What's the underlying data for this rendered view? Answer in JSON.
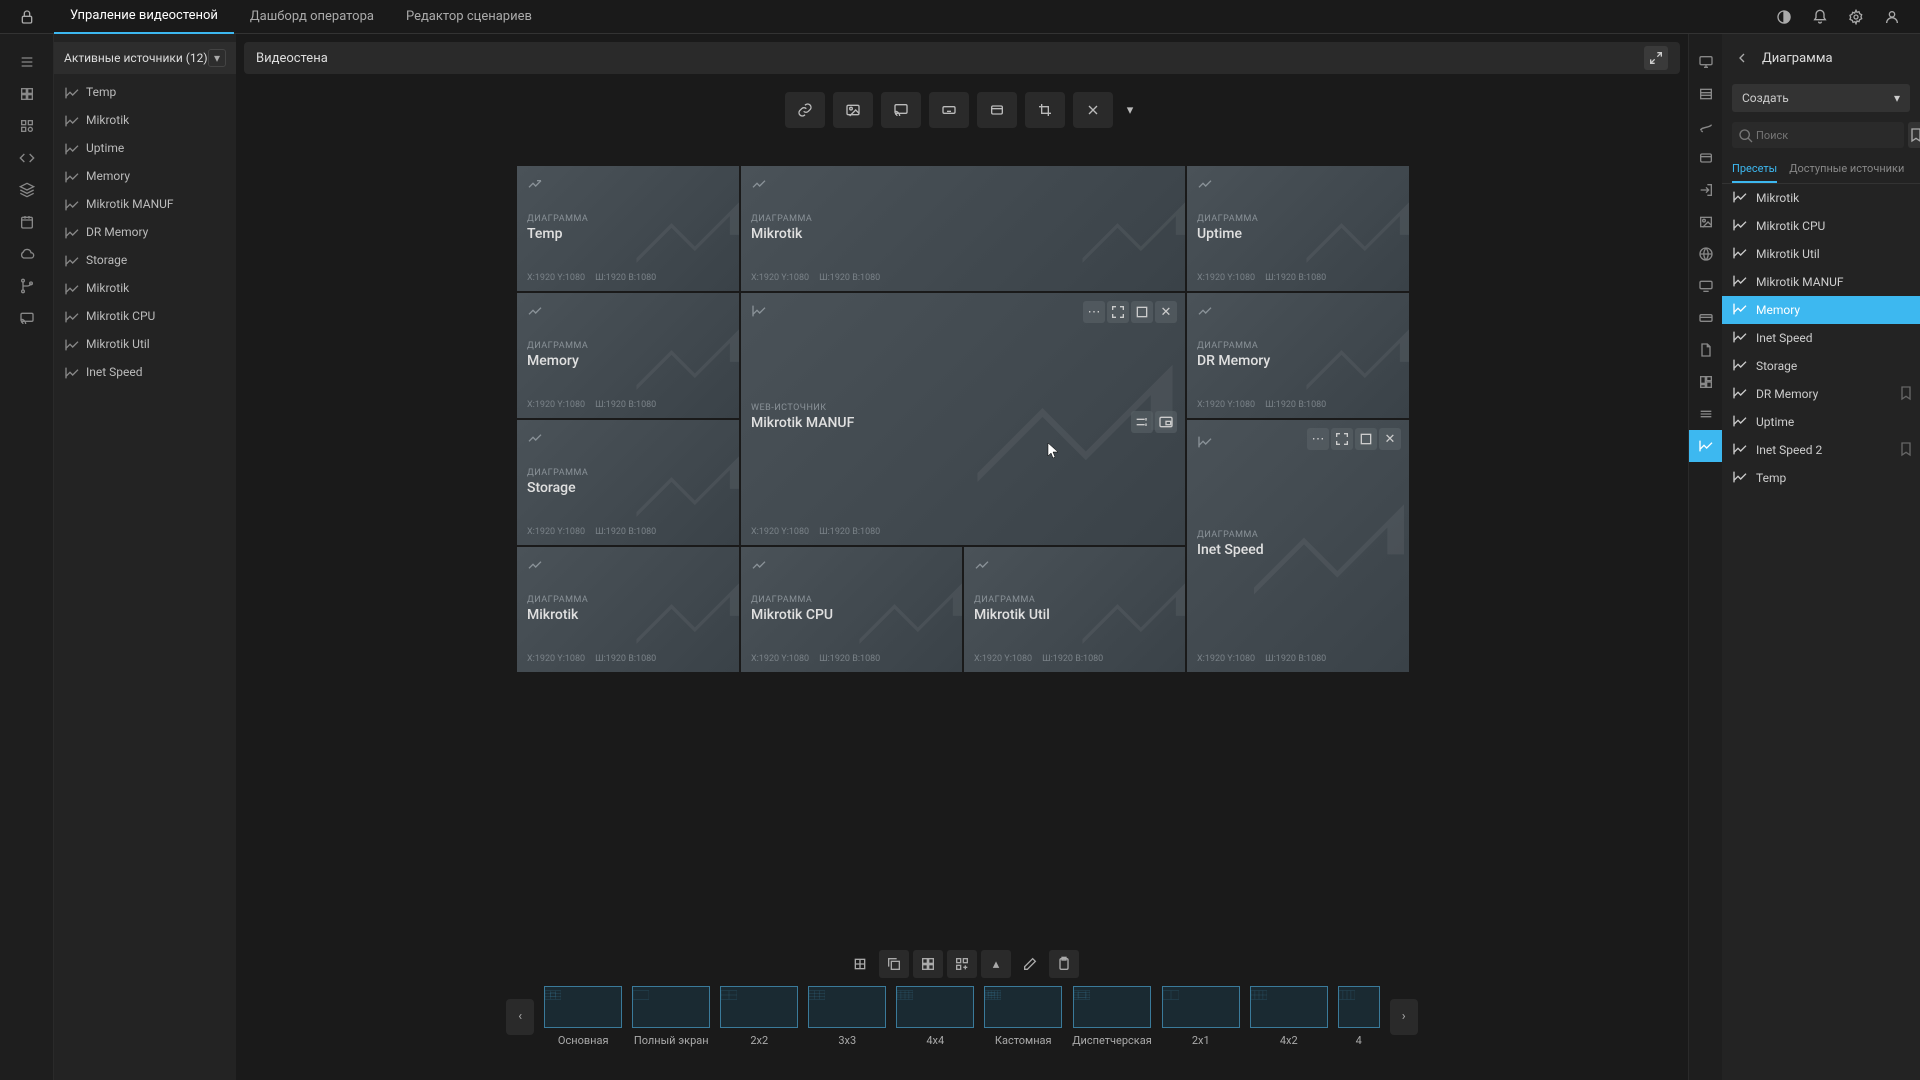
{
  "topbar": {
    "tabs": [
      "Упраление видеостеной",
      "Дашборд оператора",
      "Редактор сценариев"
    ],
    "active_tab": 0
  },
  "sidebar": {
    "header": "Активные источники (12)",
    "items": [
      "Temp",
      "Mikrotik",
      "Uptime",
      "Memory",
      "Mikrotik MANUF",
      "DR Memory",
      "Storage",
      "Mikrotik",
      "Mikrotik CPU",
      "Mikrotik Util",
      "Inet Speed"
    ]
  },
  "center": {
    "title": "Видеостена",
    "diag_label": "ДИАГРАММА",
    "web_label": "Web-источник",
    "diag_label2": "Диаграмма",
    "xy": "X:1920 Y:1080",
    "wh": "Ш:1920 В:1080",
    "tiles": {
      "t1": "Temp",
      "t2": "Mikrotik",
      "t3": "Uptime",
      "t4": "Memory",
      "t5": "Mikrotik MANUF",
      "t6": "DR Memory",
      "t7": "Storage",
      "t8": "Inet Speed",
      "t9": "Mikrotik",
      "t10": "Mikrotik CPU",
      "t11": "Mikrotik Util"
    }
  },
  "layouts": [
    "Основная",
    "Полный экран",
    "2x2",
    "3x3",
    "4x4",
    "Кастомная",
    "Диспетчерская",
    "2x1",
    "4x2",
    "4"
  ],
  "rightpanel": {
    "title": "Диаграмма",
    "create": "Создать",
    "search_placeholder": "Поиск",
    "tabs": [
      "Пресеты",
      "Доступные источники"
    ],
    "active_tab": 0,
    "items": [
      {
        "label": "Mikrotik",
        "bm": false
      },
      {
        "label": "Mikrotik CPU",
        "bm": false
      },
      {
        "label": "Mikrotik Util",
        "bm": false
      },
      {
        "label": "Mikrotik MANUF",
        "bm": false
      },
      {
        "label": "Memory",
        "bm": false,
        "selected": true
      },
      {
        "label": "Inet Speed",
        "bm": false
      },
      {
        "label": "Storage",
        "bm": false
      },
      {
        "label": "DR Memory",
        "bm": true
      },
      {
        "label": "Uptime",
        "bm": false
      },
      {
        "label": "Inet Speed 2",
        "bm": true
      },
      {
        "label": "Temp",
        "bm": false
      }
    ]
  }
}
